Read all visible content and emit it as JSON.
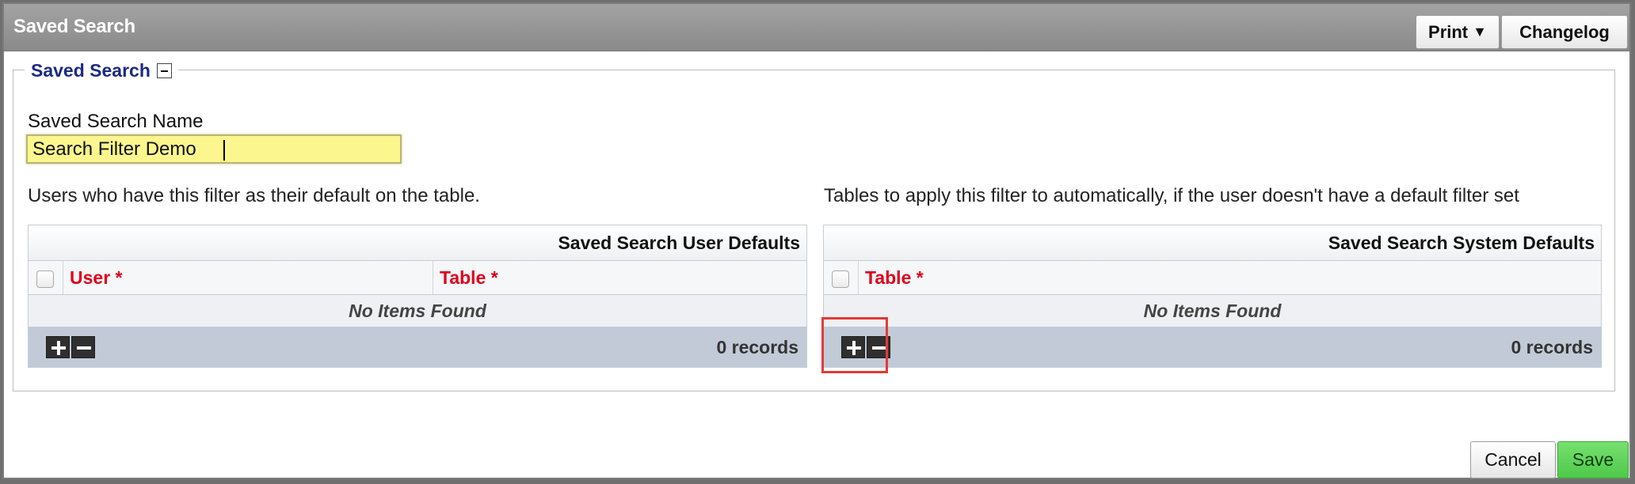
{
  "window": {
    "title": "Saved Search"
  },
  "toolbar": {
    "print_label": "Print",
    "print_arrow": "▼",
    "changelog_label": "Changelog"
  },
  "section": {
    "legend": "Saved Search",
    "collapse_icon": "minus-box-icon"
  },
  "form": {
    "name_label": "Saved Search Name",
    "name_value": "Search Filter Demo",
    "user_defaults_desc": "Users who have this filter as their default on the table.",
    "system_defaults_desc": "Tables to apply this filter to automatically, if the user doesn't have a default filter set"
  },
  "user_defaults_grid": {
    "title": "Saved Search User Defaults",
    "columns": [
      "User *",
      "Table *"
    ],
    "empty_text": "No Items Found",
    "records": "0 records"
  },
  "system_defaults_grid": {
    "title": "Saved Search System Defaults",
    "columns": [
      "Table *"
    ],
    "empty_text": "No Items Found",
    "records": "0 records"
  },
  "actions": {
    "cancel_label": "Cancel",
    "save_label": "Save"
  },
  "colors": {
    "required_column": "#e0001b",
    "legend": "#1c2a80",
    "save_button": "#5fd45a",
    "highlight_box": "#e53935"
  }
}
